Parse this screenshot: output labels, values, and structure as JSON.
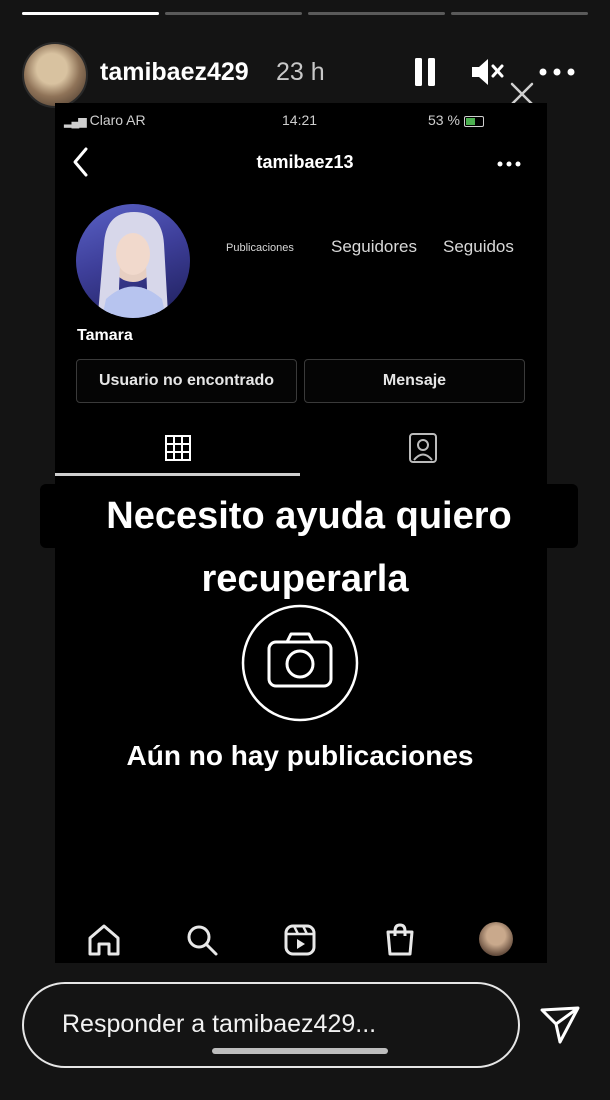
{
  "story": {
    "progress": [
      1.0,
      0.0,
      0.0,
      0.0
    ],
    "username": "tamibaez429",
    "time": "23 h",
    "reply_placeholder": "Responder a tamibaez429..."
  },
  "screenshot": {
    "status_bar": {
      "carrier": "Claro AR",
      "time": "14:21",
      "battery": "53 %"
    },
    "profile": {
      "username": "tamibaez13",
      "display_name": "Tamara",
      "stats": {
        "posts_label": "Publicaciones",
        "followers_label": "Seguidores",
        "following_label": "Seguidos"
      },
      "buttons": {
        "user_status": "Usuario no encontrado",
        "message": "Mensaje"
      },
      "empty_state": "Aún no hay publicaciones"
    }
  },
  "caption": {
    "line1": "Necesito ayuda quiero",
    "line2": "recuperarla"
  },
  "colors": {
    "background": "#141414",
    "inner_background": "#000000"
  }
}
